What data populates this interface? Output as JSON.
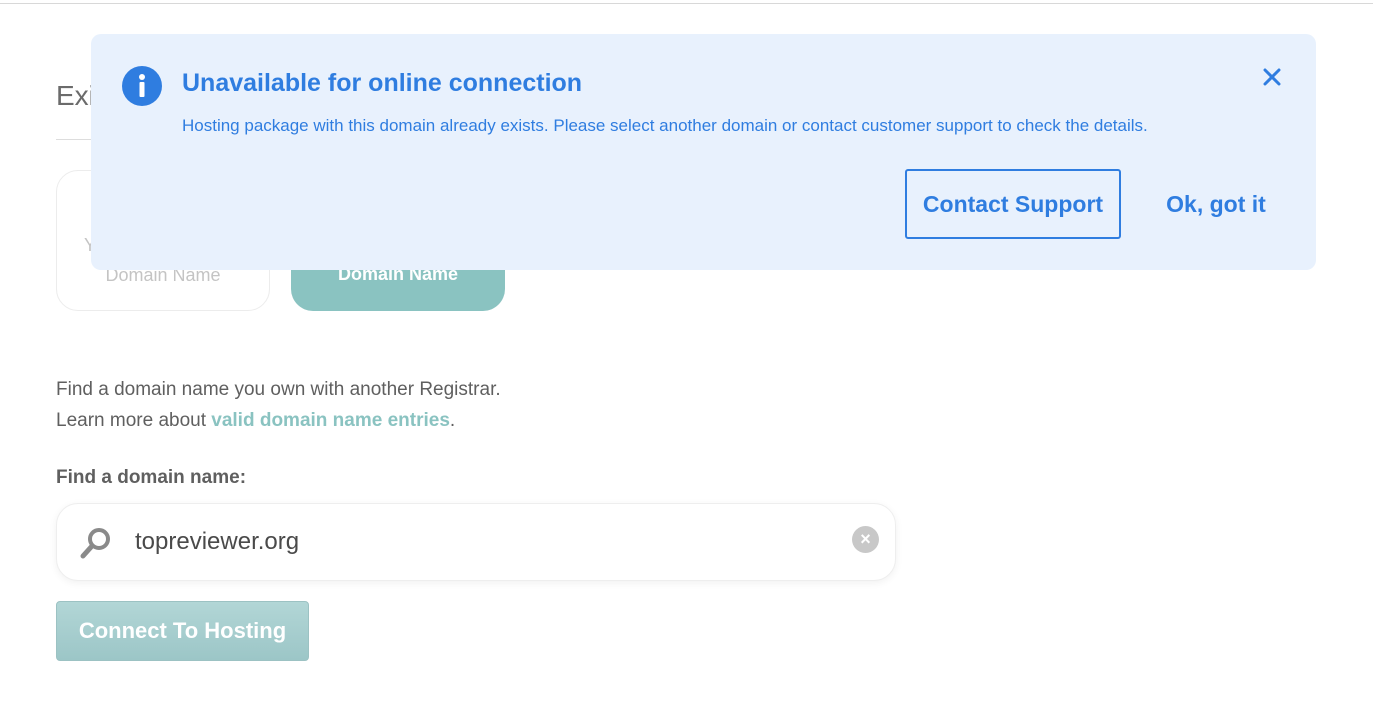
{
  "section": {
    "title": "Exi"
  },
  "options": {
    "inactive": {
      "line1": "Y",
      "line2": "Domain Name"
    },
    "active": {
      "line2": "Domain Name"
    }
  },
  "intro": {
    "line1": "Find a domain name you own with another Registrar.",
    "line2_prefix": "Learn more about ",
    "link_text": "valid domain name entries",
    "line2_suffix": "."
  },
  "search": {
    "label": "Find a domain name:",
    "value": "topreviewer.org",
    "icon": "search-icon",
    "clear_icon": "clear-icon"
  },
  "connect_button": {
    "label": "Connect To Hosting"
  },
  "notice": {
    "title": "Unavailable for online connection",
    "message": "Hosting package with this domain already exists. Please select another domain or contact customer support to check the details.",
    "contact_label": "Contact Support",
    "ok_label": "Ok, got it",
    "icon": "info-icon",
    "close_icon": "close-icon"
  },
  "colors": {
    "accent": "#2f7de0",
    "notice_bg": "#e8f1fd",
    "teal": "#8ac3c1"
  }
}
